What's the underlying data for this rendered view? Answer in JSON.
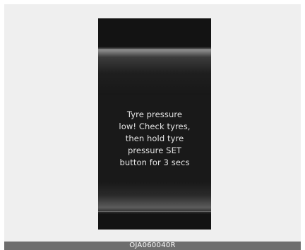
{
  "display": {
    "message_lines": [
      "Tyre pressure",
      "low! Check tyres,",
      "then hold tyre",
      "pressure SET",
      "button for 3 secs"
    ]
  },
  "caption": {
    "code": "OJA060040R"
  },
  "colors": {
    "page_background": "#efefef",
    "display_background": "#131313",
    "message_text": "#e6e6e6",
    "caption_background": "#6e6e6e",
    "caption_text": "#ffffff"
  }
}
